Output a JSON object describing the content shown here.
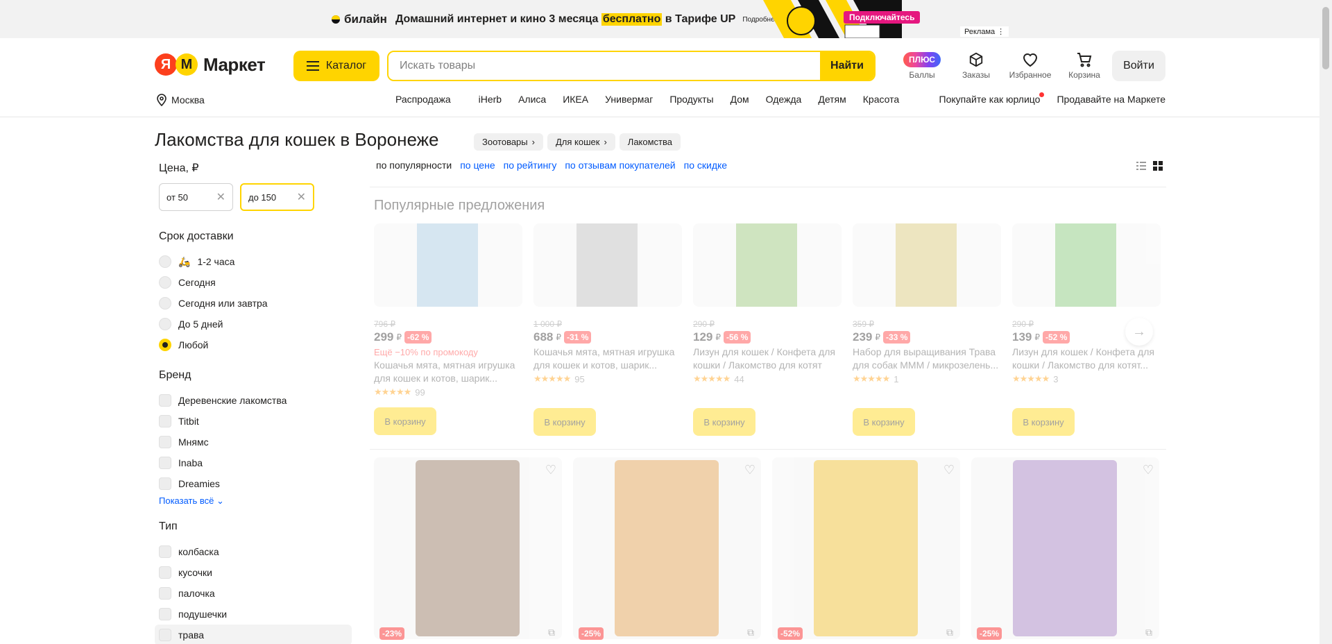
{
  "ad": {
    "brand": "билайн",
    "text_before": "Домашний интернет и кино 3 месяца",
    "highlight": "бесплатно",
    "text_after": "в Тарифе UP",
    "more": "Подробнее на beeline.ru",
    "cta": "Подключайтесь",
    "label": "Реклама ⋮"
  },
  "header": {
    "logo_text": "Маркет",
    "catalog": "Каталог",
    "search_placeholder": "Искать товары",
    "search_button": "Найти",
    "plus_badge": "ПЛЮС",
    "icons": [
      "Баллы",
      "Заказы",
      "Избранное",
      "Корзина"
    ],
    "login": "Войти",
    "location": "Москва",
    "nav": [
      "Распродажа",
      "iHerb",
      "Алиса",
      "ИКЕА",
      "Универмаг",
      "Продукты",
      "Дом",
      "Одежда",
      "Детям",
      "Красота"
    ],
    "nav_right": [
      "Покупайте как юрлицо",
      "Продавайте на Маркете"
    ]
  },
  "page": {
    "title": "Лакомства для кошек в Воронеже",
    "breadcrumbs": [
      "Зоотовары",
      "Для кошек",
      "Лакомства"
    ]
  },
  "filters": {
    "price_title": "Цена, ₽",
    "price_from": "от 50",
    "price_to": "до 150",
    "delivery_title": "Срок доставки",
    "delivery": [
      "1-2 часа",
      "Сегодня",
      "Сегодня или завтра",
      "До 5 дней",
      "Любой"
    ],
    "delivery_selected": "Любой",
    "brand_title": "Бренд",
    "brands": [
      "Деревенские лакомства",
      "Titbit",
      "Мнямс",
      "Inaba",
      "Dreamies"
    ],
    "show_all": "Показать всё",
    "type_title": "Тип",
    "types": [
      "колбаска",
      "кусочки",
      "палочка",
      "подушечки",
      "трава"
    ]
  },
  "sort": {
    "current": "по популярности",
    "links": [
      "по цене",
      "по рейтингу",
      "по отзывам покупателей",
      "по скидке"
    ]
  },
  "popular": {
    "title": "Популярные предложения",
    "cart_label": "В корзину",
    "items": [
      {
        "old": "796 ₽",
        "price": "299",
        "disc": "-62 %",
        "promo": "Ещё −10% по промокоду",
        "name": "Кошачья мята, мятная игрушка для кошек и котов, шарик...",
        "stars": "★★★★★",
        "reviews": "99",
        "color": "#9fc4de"
      },
      {
        "old": "1 000 ₽",
        "price": "688",
        "disc": "-31 %",
        "promo": "",
        "name": "Кошачья мята, мятная игрушка для кошек и котов, шарик...",
        "stars": "★★★★★",
        "reviews": "95",
        "color": "#b7b7b7"
      },
      {
        "old": "290 ₽",
        "price": "129",
        "disc": "-56 %",
        "promo": "",
        "name": "Лизун для кошек / Конфета для кошки / Лакомство для котят",
        "stars": "★★★★★",
        "reviews": "44",
        "color": "#8fbf6a"
      },
      {
        "old": "359 ₽",
        "price": "239",
        "disc": "-33 %",
        "promo": "",
        "name": "Набор для выращивания Трава для собак МММ / микрозелень...",
        "stars": "★★★★★",
        "reviews": "1",
        "color": "#d5c36a"
      },
      {
        "old": "290 ₽",
        "price": "139",
        "disc": "-52 %",
        "promo": "",
        "name": "Лизун для кошек / Конфета для кошки / Лакомство для котят...",
        "stars": "★★★★★",
        "reviews": "3",
        "color": "#78c36a"
      }
    ]
  },
  "grid": {
    "items": [
      {
        "disc": "-23%",
        "color": "#9a7f6a"
      },
      {
        "disc": "-25%",
        "color": "#e2a55a"
      },
      {
        "disc": "-52%",
        "color": "#f0c33a"
      },
      {
        "disc": "-25%",
        "color": "#a886c4"
      }
    ]
  }
}
